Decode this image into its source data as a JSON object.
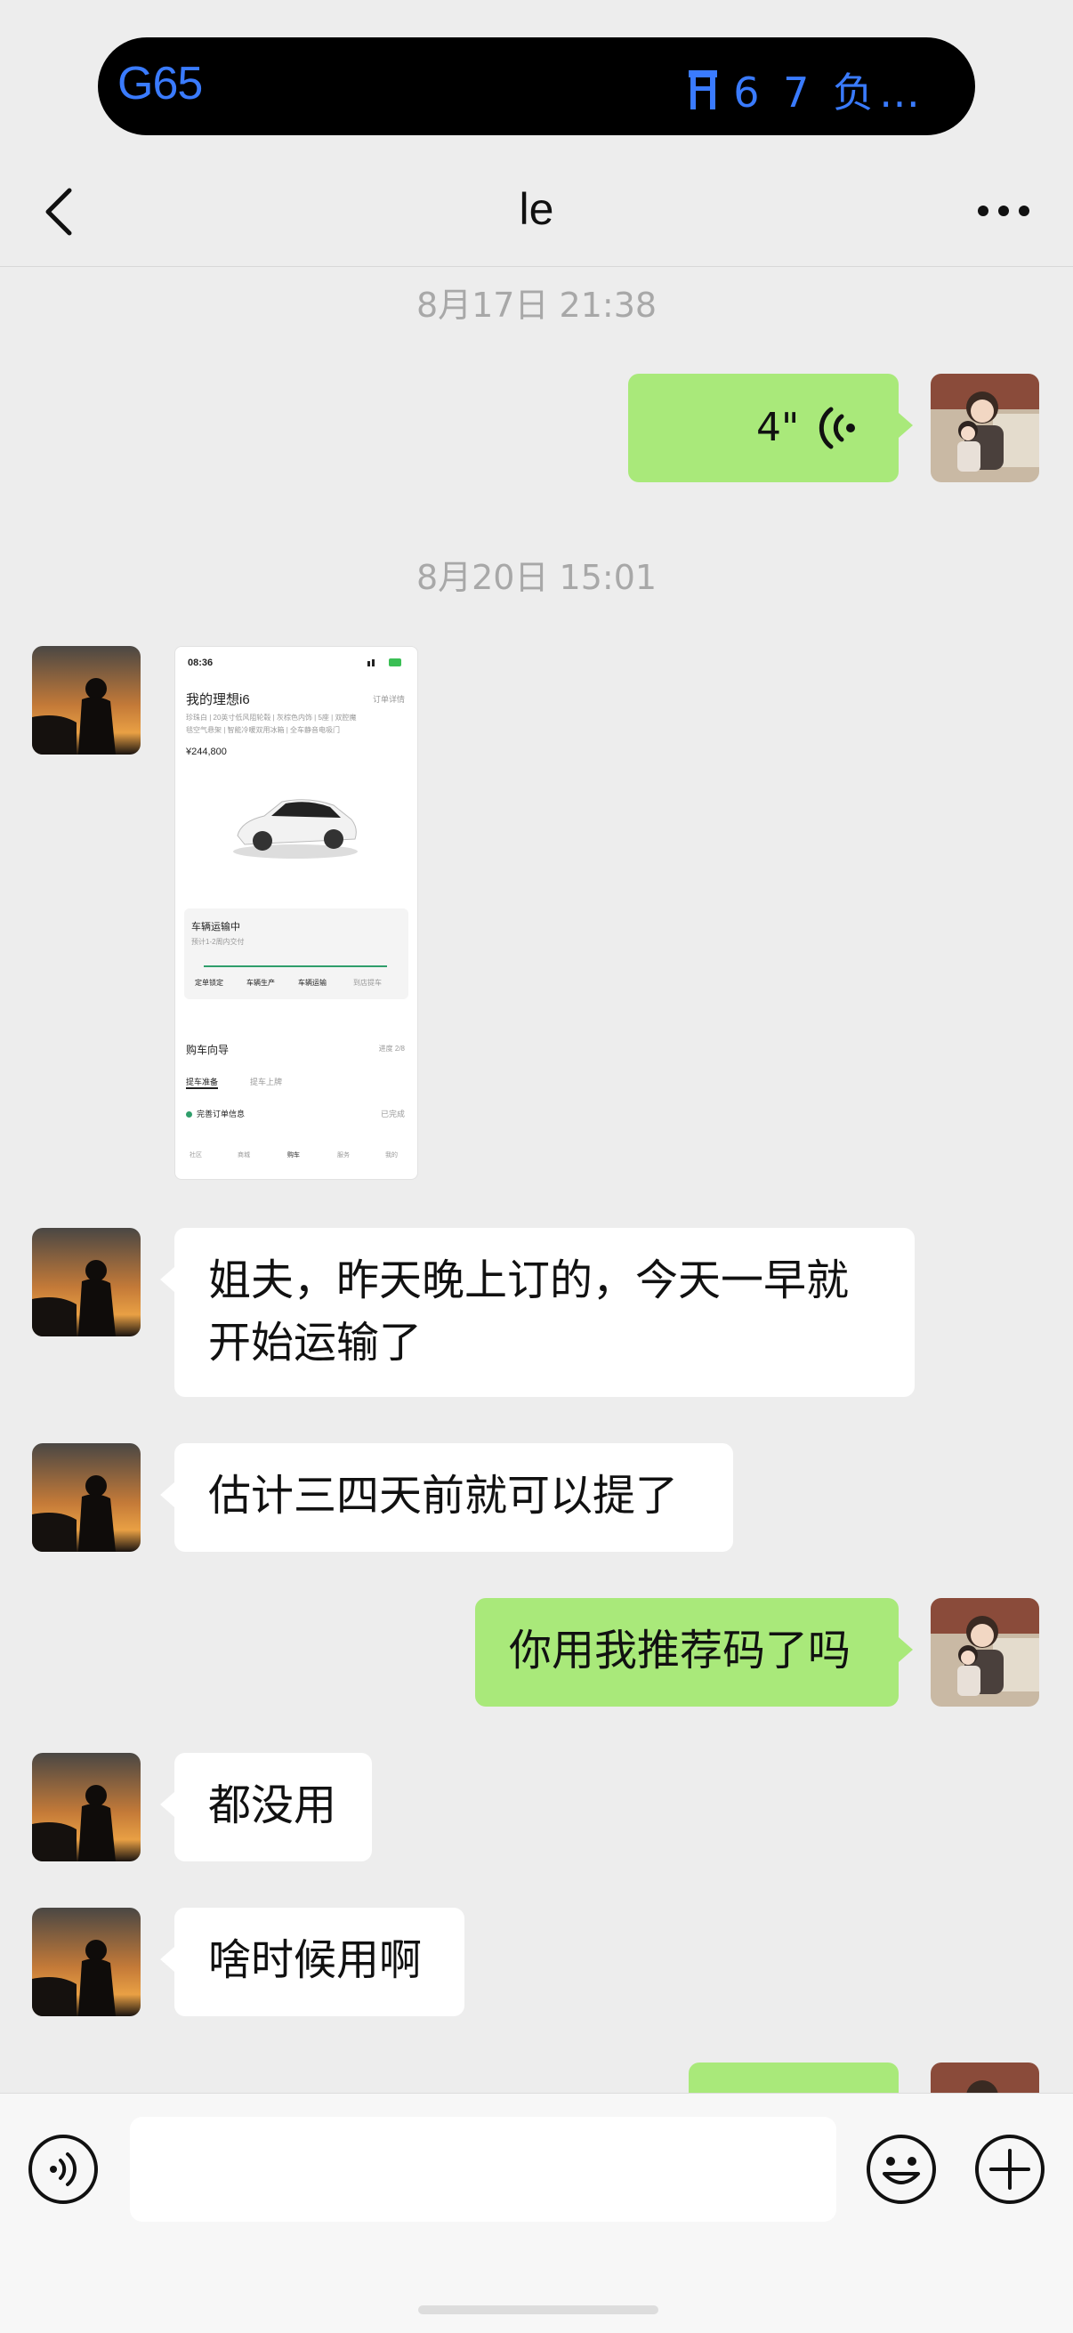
{
  "status": {
    "route": "G65",
    "info": "6 7 负…",
    "info_icon": "transit-icon"
  },
  "header": {
    "title": "le",
    "back_icon": "chevron-left-icon",
    "more_icon": "more-dots-icon"
  },
  "timestamps": [
    "8月17日 21:38",
    "8月20日 15:01"
  ],
  "messages": {
    "voice": {
      "duration": "4\"",
      "icon": "voice-wave-icon"
    },
    "shared_image": {
      "time": "08:36",
      "title": "我的理想i6",
      "order_detail": "订单详情",
      "spec_1": "珍珠白 | 20英寸低风阻轮毂 | 灰棕色内饰 | 5座 | 双腔魔",
      "spec_2": "毯空气悬架 | 智能冷暖双用冰箱 | 全车静音电吸门",
      "price": "¥244,800",
      "transport_status": "车辆运输中",
      "eta": "预计1-2周内交付",
      "steps": [
        "定单锁定",
        "车辆生产",
        "车辆运输",
        "到店提车"
      ],
      "guide_title": "购车向导",
      "guide_progress": "进度 2/8",
      "tabs": [
        "提车准备",
        "提车上牌"
      ],
      "task": "完善订单信息",
      "task_status": "已完成",
      "nav": [
        "社区",
        "商城",
        "购车",
        "服务",
        "我的"
      ]
    },
    "text_1": "姐夫，昨天晚上订的，今天一早就\n开始运输了",
    "text_2": "估计三四天前就可以提了",
    "text_3": "你用我推荐码了吗",
    "text_4": "都没用",
    "text_5": "啥时候用啊"
  },
  "input_bar": {
    "voice_icon": "voice-input-icon",
    "emoji_icon": "emoji-icon",
    "plus_icon": "plus-icon"
  },
  "colors": {
    "outgoing_bubble": "#a9e97a",
    "incoming_bubble": "#ffffff",
    "background": "#ededed",
    "island_text": "#3a7bff"
  }
}
